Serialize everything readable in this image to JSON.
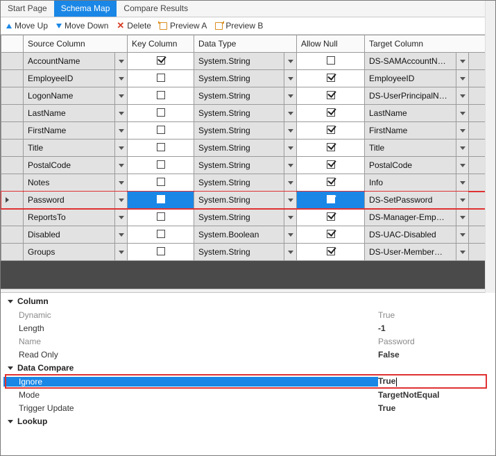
{
  "tabs": [
    "Start Page",
    "Schema Map",
    "Compare Results"
  ],
  "active_tab": 1,
  "toolbar": {
    "move_up": "Move Up",
    "move_down": "Move Down",
    "delete": "Delete",
    "preview_a": "Preview A",
    "preview_b": "Preview B"
  },
  "grid": {
    "headers": {
      "source": "Source Column",
      "key": "Key Column",
      "dtype": "Data Type",
      "null": "Allow Null",
      "target": "Target Column"
    },
    "rows": [
      {
        "source": "AccountName",
        "key": true,
        "dtype": "System.String",
        "null": false,
        "target": "DS-SAMAccountN…"
      },
      {
        "source": "EmployeeID",
        "key": false,
        "dtype": "System.String",
        "null": true,
        "target": "EmployeeID"
      },
      {
        "source": "LogonName",
        "key": false,
        "dtype": "System.String",
        "null": true,
        "target": "DS-UserPrincipalN…"
      },
      {
        "source": "LastName",
        "key": false,
        "dtype": "System.String",
        "null": true,
        "target": "LastName"
      },
      {
        "source": "FirstName",
        "key": false,
        "dtype": "System.String",
        "null": true,
        "target": "FirstName"
      },
      {
        "source": "Title",
        "key": false,
        "dtype": "System.String",
        "null": true,
        "target": "Title"
      },
      {
        "source": "PostalCode",
        "key": false,
        "dtype": "System.String",
        "null": true,
        "target": "PostalCode"
      },
      {
        "source": "Notes",
        "key": false,
        "dtype": "System.String",
        "null": true,
        "target": "Info"
      },
      {
        "source": "Password",
        "key": false,
        "dtype": "System.String",
        "null": true,
        "target": "DS-SetPassword",
        "selected": true,
        "highlighted": true
      },
      {
        "source": "ReportsTo",
        "key": false,
        "dtype": "System.String",
        "null": true,
        "target": "DS-Manager-Emp…"
      },
      {
        "source": "Disabled",
        "key": false,
        "dtype": "System.Boolean",
        "null": true,
        "target": "DS-UAC-Disabled"
      },
      {
        "source": "Groups",
        "key": false,
        "dtype": "System.String",
        "null": true,
        "target": "DS-User-Member…"
      }
    ]
  },
  "props": {
    "groups": [
      {
        "title": "Column",
        "items": [
          {
            "k": "Dynamic",
            "v": "True",
            "dim": true
          },
          {
            "k": "Length",
            "v": "-1",
            "bold": true
          },
          {
            "k": "Name",
            "v": "Password",
            "dim": true
          },
          {
            "k": "Read Only",
            "v": "False",
            "bold": true
          }
        ]
      },
      {
        "title": "Data Compare",
        "items": [
          {
            "k": "Ignore",
            "v": "True",
            "selected": true,
            "bold": true,
            "editing": true
          },
          {
            "k": "Mode",
            "v": "TargetNotEqual",
            "bold": true
          },
          {
            "k": "Trigger Update",
            "v": "True",
            "bold": true
          }
        ]
      },
      {
        "title": "Lookup",
        "items": []
      }
    ]
  }
}
